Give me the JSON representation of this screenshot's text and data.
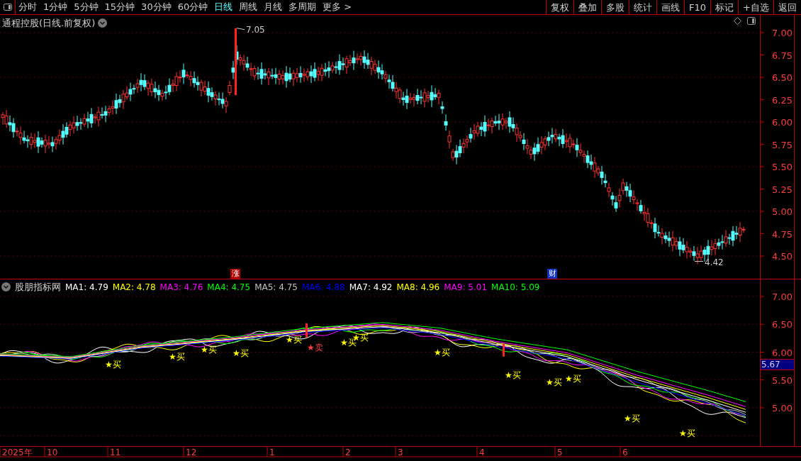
{
  "toolbar": {
    "periods": [
      {
        "label": "分时",
        "selected": false
      },
      {
        "label": "1分钟",
        "selected": false
      },
      {
        "label": "5分钟",
        "selected": false
      },
      {
        "label": "15分钟",
        "selected": false
      },
      {
        "label": "30分钟",
        "selected": false
      },
      {
        "label": "60分钟",
        "selected": false
      },
      {
        "label": "日线",
        "selected": true
      },
      {
        "label": "周线",
        "selected": false
      },
      {
        "label": "月线",
        "selected": false
      },
      {
        "label": "多周期",
        "selected": false
      },
      {
        "label": "更多 >",
        "selected": false
      }
    ],
    "actions": [
      "复权",
      "叠加",
      "多股",
      "统计",
      "画线",
      "F10",
      "标记",
      "+自选",
      "返回"
    ]
  },
  "main_panel": {
    "title": "通程控股(日线.前复权)",
    "price_axis": [
      "7.00",
      "6.75",
      "6.50",
      "6.25",
      "6.00",
      "5.75",
      "5.50",
      "5.25",
      "5.00",
      "4.75",
      "4.50"
    ],
    "high_label": "7.05",
    "low_label": "4.42",
    "event_markers": [
      {
        "text": "涨",
        "color": "#b00000"
      },
      {
        "text": "财",
        "color": "#1030c0"
      }
    ]
  },
  "indicator_panel": {
    "name": "股朋指标网",
    "legend": [
      {
        "label": "MA1: 4.79",
        "color": "#ffffff"
      },
      {
        "label": "MA2: 4.78",
        "color": "#ffff00"
      },
      {
        "label": "MA3: 4.76",
        "color": "#ff00ff"
      },
      {
        "label": "MA4: 4.75",
        "color": "#00ff00"
      },
      {
        "label": "MA5: 4.75",
        "color": "#c0c0c0"
      },
      {
        "label": "MA6: 4.88",
        "color": "#0000ff"
      },
      {
        "label": "MA7: 4.92",
        "color": "#ffffff"
      },
      {
        "label": "MA8: 4.96",
        "color": "#ffff00"
      },
      {
        "label": "MA9: 5.01",
        "color": "#ff00ff"
      },
      {
        "label": "MA10: 5.09",
        "color": "#00ff00"
      }
    ],
    "value_axis": [
      "7.00",
      "6.50",
      "6.00",
      "5.50",
      "5.00"
    ],
    "current_value": "5.67",
    "signals": [
      "★买",
      "★买",
      "★买",
      "★买",
      "★买",
      "★卖",
      "★买",
      "★买",
      "★买",
      "★买",
      "★买",
      "★买",
      "★买",
      "★买"
    ]
  },
  "date_axis": [
    "2025年",
    "10",
    "11",
    "12",
    "1",
    "2",
    "3",
    "4",
    "5",
    "6"
  ]
}
